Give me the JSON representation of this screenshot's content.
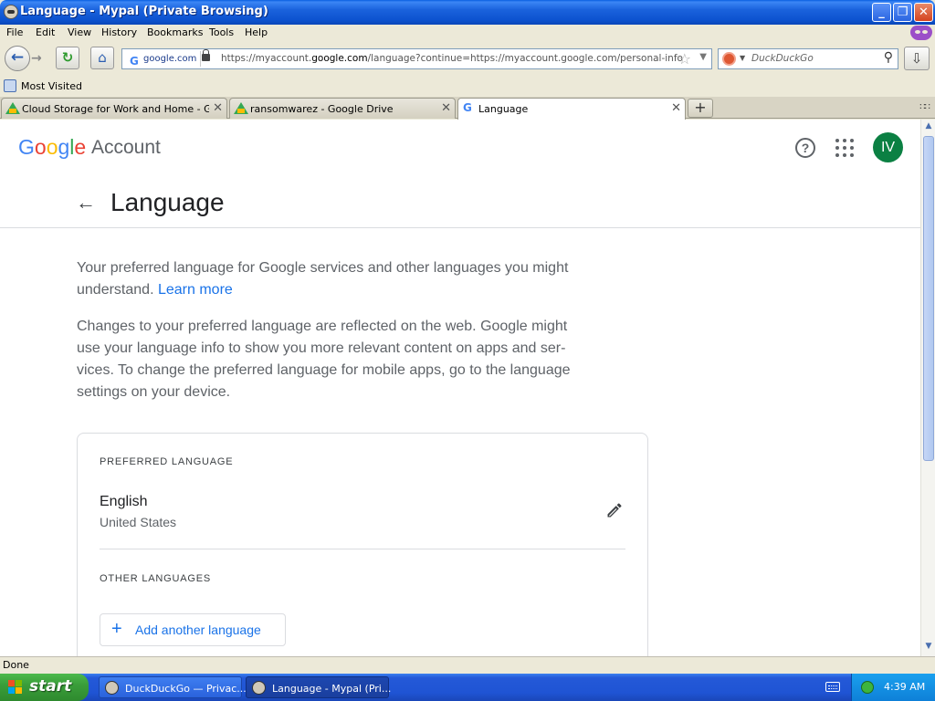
{
  "window": {
    "title": "Language - Mypal (Private Browsing)",
    "controls": {
      "minimize": "_",
      "maximize": "❐",
      "close": "✕"
    }
  },
  "menu": [
    "File",
    "Edit",
    "View",
    "History",
    "Bookmarks",
    "Tools",
    "Help"
  ],
  "nav": {
    "site_identity": "google.com",
    "url_prefix": "https://myaccount.",
    "url_domain": "google.com",
    "url_suffix": "/language?continue=https://myaccount.google.com/personal-info",
    "search_placeholder": "DuckDuckGo"
  },
  "bookmarks_bar": {
    "item": "Most Visited"
  },
  "tabs": [
    {
      "label": "Cloud Storage for Work and Home - Goo...",
      "active": false
    },
    {
      "label": "ransomwarez - Google Drive",
      "active": false
    },
    {
      "label": "Language",
      "active": true
    }
  ],
  "page": {
    "logo_letters": [
      "G",
      "o",
      "o",
      "g",
      "l",
      "e"
    ],
    "logo_suffix": "Account",
    "avatar_initials": "IV",
    "help_glyph": "?",
    "title": "Language",
    "intro_text": "Your preferred language for Google services and other languages you might understand.",
    "learn_more": "Learn more",
    "info_line1": "Changes to your preferred language are reflected on the web. Google might",
    "info_line2": "use your language info to show you more relevant content on apps and ser-",
    "info_line3": "vices. To change the preferred language for mobile apps, go to the language",
    "info_line4": "settings on your device.",
    "preferred_label": "PREFERRED LANGUAGE",
    "preferred_language": "English",
    "preferred_region": "United States",
    "other_label": "OTHER LANGUAGES",
    "add_button": "Add another language"
  },
  "status": "Done",
  "taskbar": {
    "start": "start",
    "tasks": [
      "DuckDuckGo — Privac...",
      "Language - Mypal (Pri..."
    ],
    "clock": "4:39 AM"
  },
  "colors": {
    "accent_blue": "#1a73e8",
    "avatar_green": "#0b8043",
    "text_secondary": "#5f6368"
  }
}
